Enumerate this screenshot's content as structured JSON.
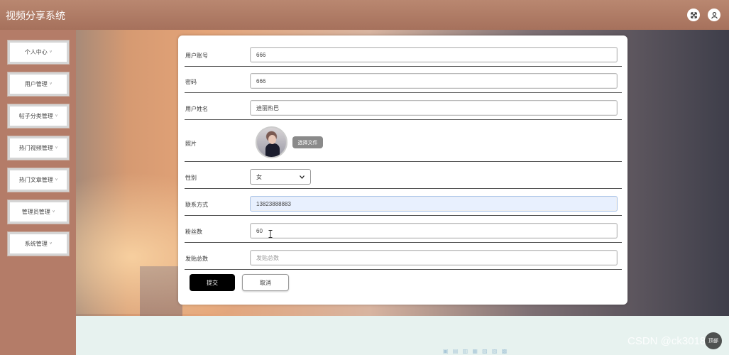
{
  "app": {
    "title": "视频分享系统"
  },
  "header": {
    "fullscreen_icon": "expand-arrows-icon",
    "user_icon": "user-icon"
  },
  "sidebar": {
    "items": [
      {
        "label": "个人中心",
        "caret": "˅"
      },
      {
        "label": "用户管理",
        "caret": "˅"
      },
      {
        "label": "帖子分类管理",
        "caret": "˅"
      },
      {
        "label": "热门视频管理",
        "caret": "˅"
      },
      {
        "label": "热门文章管理",
        "caret": "˅"
      },
      {
        "label": "管理员管理",
        "caret": "˅"
      },
      {
        "label": "系统管理",
        "caret": "˅"
      }
    ]
  },
  "form": {
    "account": {
      "label": "用户账号",
      "value": "666"
    },
    "password": {
      "label": "密码",
      "value": "666"
    },
    "name": {
      "label": "用户姓名",
      "value": "迪丽热巴"
    },
    "photo": {
      "label": "照片",
      "button": "选择文件"
    },
    "gender": {
      "label": "性别",
      "value": "女",
      "options": [
        "女"
      ]
    },
    "phone": {
      "label": "联系方式",
      "value": "13823888883"
    },
    "fans": {
      "label": "粉丝数",
      "value": "60"
    },
    "posts": {
      "label": "发贴总数",
      "placeholder": "发贴总数"
    },
    "submit": "提交",
    "cancel": "取消"
  },
  "watermark": "CSDN @ck3018",
  "back_to_top": "顶部"
}
